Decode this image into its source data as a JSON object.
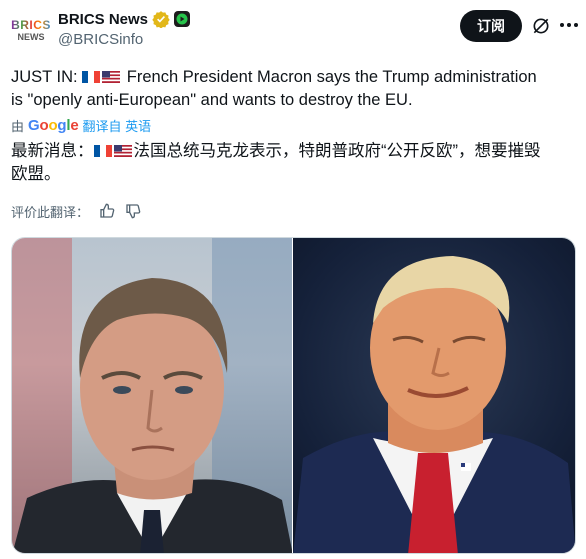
{
  "author": {
    "avatar_line1": "BRICS",
    "avatar_line2": "NEWS",
    "display_name": "BRICS News",
    "handle": "@BRICSinfo"
  },
  "actions": {
    "follow_label": "订阅"
  },
  "tweet": {
    "original_line1": "JUST IN: ",
    "original_line1_rest": " French President Macron says the Trump administration",
    "original_line2": "is \"openly anti-European\" and wants to destroy the EU.",
    "translated_by_label": "由",
    "translate_link": "翻译自 英语",
    "translated_prefix": "最新消息：",
    "translated_rest": "法国总统马克龙表示，特朗普政府“公开反欧”，想要摧毁",
    "translated_line2": "欧盟。",
    "rate_label": "评价此翻译："
  },
  "media": {
    "left_photo": "macron-photo",
    "right_photo": "trump-photo"
  },
  "colors": {
    "accent": "#1d9bf0",
    "text": "#0f1419",
    "muted": "#536471",
    "verified_gold": "#e2b719"
  }
}
